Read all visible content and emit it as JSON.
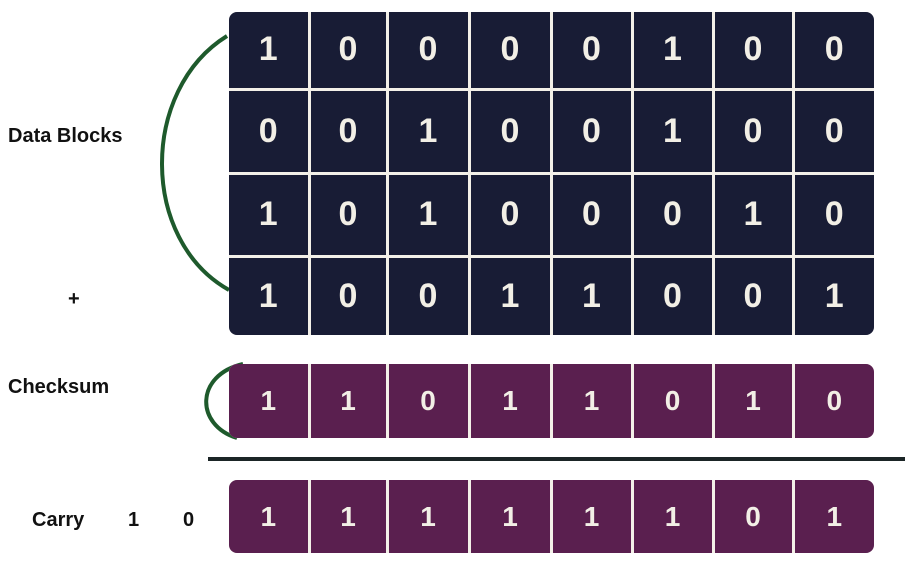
{
  "labels": {
    "data_blocks": "Data Blocks",
    "plus": "+",
    "checksum": "Checksum",
    "carry": "Carry",
    "carry_bits": [
      "1",
      "0"
    ]
  },
  "colors": {
    "data_block_fill": "#181c35",
    "checksum_fill": "#5a1f4f",
    "digit_color": "#f2efe6",
    "bracket_color": "#1e5a2c",
    "divider_color": "#1b2526"
  },
  "data_blocks": [
    [
      "1",
      "0",
      "0",
      "0",
      "0",
      "1",
      "0",
      "0"
    ],
    [
      "0",
      "0",
      "1",
      "0",
      "0",
      "1",
      "0",
      "0"
    ],
    [
      "1",
      "0",
      "1",
      "0",
      "0",
      "0",
      "1",
      "0"
    ],
    [
      "1",
      "0",
      "0",
      "1",
      "1",
      "0",
      "0",
      "1"
    ]
  ],
  "checksum": [
    "1",
    "1",
    "0",
    "1",
    "1",
    "0",
    "1",
    "0"
  ],
  "result": [
    "1",
    "1",
    "1",
    "1",
    "1",
    "1",
    "0",
    "1"
  ]
}
